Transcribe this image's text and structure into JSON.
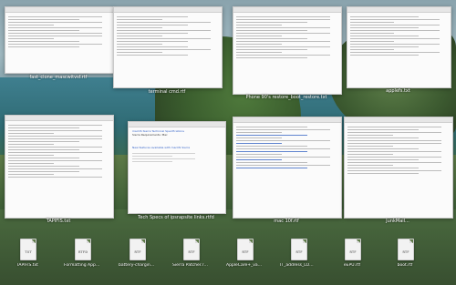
{
  "windows": [
    {
      "id": "w1",
      "label": "fast_clone_mascwitvsf.rtf"
    },
    {
      "id": "w2",
      "label": "terminal cmd.rtf"
    },
    {
      "id": "w3",
      "label": "Phone 90's restore_boot_restore.txt"
    },
    {
      "id": "w4",
      "label": "applefs.txt"
    },
    {
      "id": "w5",
      "label": "TAPIFIS.txt"
    },
    {
      "id": "w6",
      "label": "Tech Specs of ipsrapsite links.rtfd"
    },
    {
      "id": "w7",
      "label": "mac 10f.rtf"
    },
    {
      "id": "w8",
      "label": "JunkMail..."
    }
  ],
  "tech_specs": {
    "heading": "macOS Sierra Technical Specifications",
    "line1": "Sierra Requirements: Mac",
    "line2": "New features available with macOS Sierra"
  },
  "dock_files": [
    {
      "ext": "TXT",
      "name": "TAPIFIS.txt"
    },
    {
      "ext": "RTFD",
      "name": "Formatting AppleSDOGGRE..."
    },
    {
      "ext": "RTF",
      "name": "battery-charging.rtf"
    },
    {
      "ext": "RTF",
      "name": "Sierra Patcher.rtfd"
    },
    {
      "ext": "RTF",
      "name": "AppleCare+_vantage.rtf"
    },
    {
      "ext": "RTF",
      "name": "IT_address_LOG.rtf"
    },
    {
      "ext": "RTF",
      "name": "eEPU.rtf"
    },
    {
      "ext": "RTF",
      "name": "boot.rtf"
    }
  ]
}
